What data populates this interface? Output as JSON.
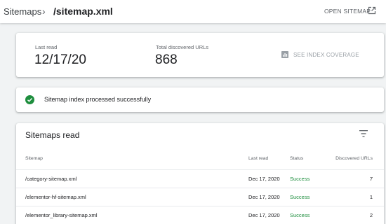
{
  "header": {
    "breadcrumb_root": "Sitemaps",
    "breadcrumb_separator": "›",
    "breadcrumb_current": "/sitemap.xml",
    "open_sitemap_label": "OPEN SITEMAP",
    "open_icon": "open-in-new-icon"
  },
  "stats": {
    "last_read_label": "Last read",
    "last_read_value": "12/17/20",
    "total_urls_label": "Total discovered URLs",
    "total_urls_value": "868",
    "index_coverage_label": "SEE INDEX COVERAGE",
    "index_coverage_icon": "bar-chart-icon"
  },
  "status_banner": {
    "icon": "check-circle-icon",
    "message": "Sitemap index processed successfully",
    "color": "#1e8e3e"
  },
  "sitemaps_table": {
    "title": "Sitemaps read",
    "filter_icon": "filter-icon",
    "columns": {
      "sitemap": "Sitemap",
      "last_read": "Last read",
      "status": "Status",
      "discovered": "Discovered URLs"
    },
    "rows": [
      {
        "sitemap": "/category-sitemap.xml",
        "last_read": "Dec 17, 2020",
        "status": "Success",
        "discovered": "7"
      },
      {
        "sitemap": "/elementor-hf-sitemap.xml",
        "last_read": "Dec 17, 2020",
        "status": "Success",
        "discovered": "1"
      },
      {
        "sitemap": "/elementor_library-sitemap.xml",
        "last_read": "Dec 17, 2020",
        "status": "Success",
        "discovered": "2"
      }
    ]
  }
}
